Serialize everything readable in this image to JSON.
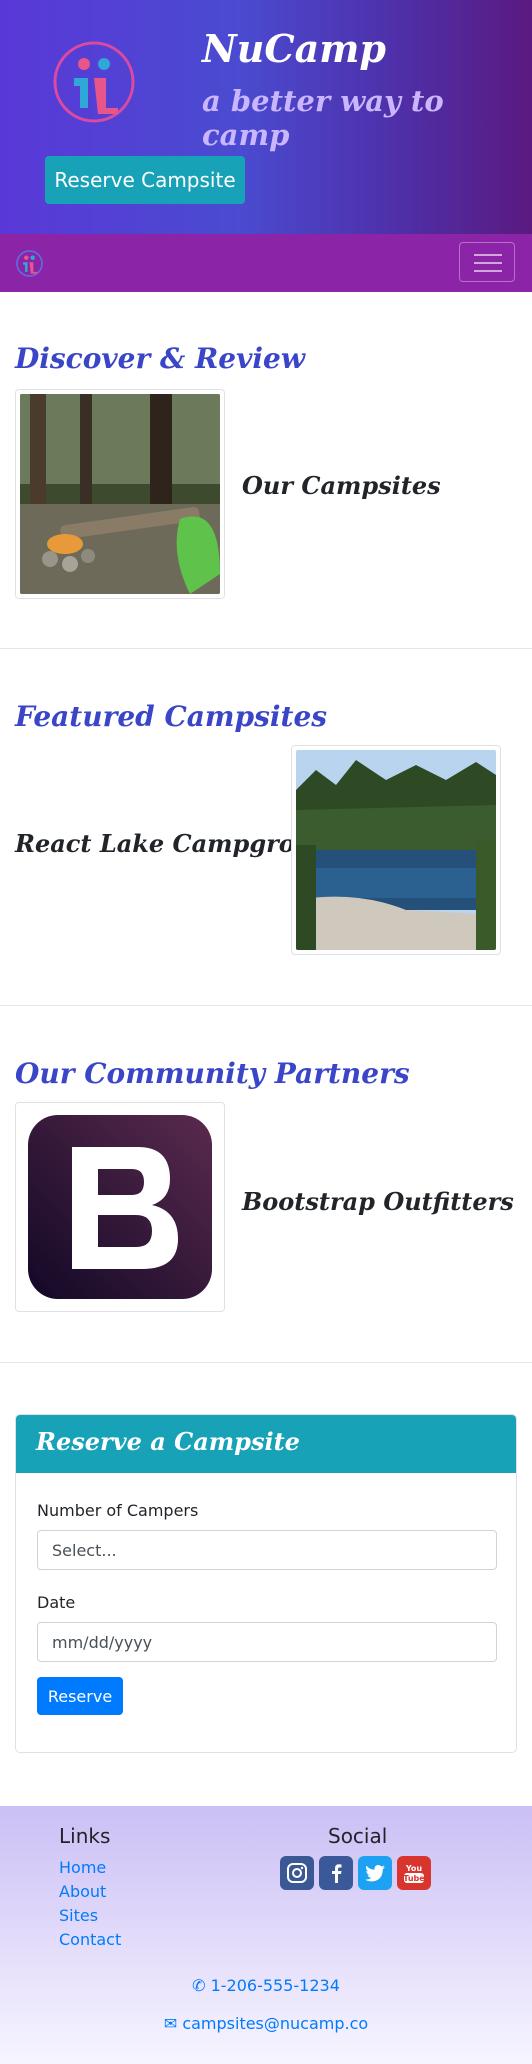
{
  "header": {
    "title": "NuCamp",
    "subtitle": "a better way to camp",
    "reserve_button": "Reserve Campsite"
  },
  "navbar": {
    "toggler_icon": "hamburger-icon"
  },
  "sections": {
    "discover": {
      "title": "Discover & Review",
      "item_title": "Our Campsites"
    },
    "featured": {
      "title": "Featured Campsites",
      "item_title": "React Lake Campground"
    },
    "partners": {
      "title": "Our Community Partners",
      "item_title": "Bootstrap Outfitters"
    }
  },
  "reserve_form": {
    "title": "Reserve a Campsite",
    "campers_label": "Number of Campers",
    "campers_value": "Select...",
    "date_label": "Date",
    "date_placeholder": "mm/dd/yyyy",
    "submit_label": "Reserve"
  },
  "footer": {
    "links_heading": "Links",
    "links": [
      "Home",
      "About",
      "Sites",
      "Contact"
    ],
    "social_heading": "Social",
    "social_icons": [
      "instagram-icon",
      "facebook-icon",
      "twitter-icon",
      "youtube-icon"
    ],
    "phone": "1-206-555-1234",
    "email": "campsites@nucamp.co"
  },
  "colors": {
    "accent": "#17a2b8",
    "navbar": "#8b24a6",
    "heading": "#3a45c8",
    "link": "#007bff"
  }
}
